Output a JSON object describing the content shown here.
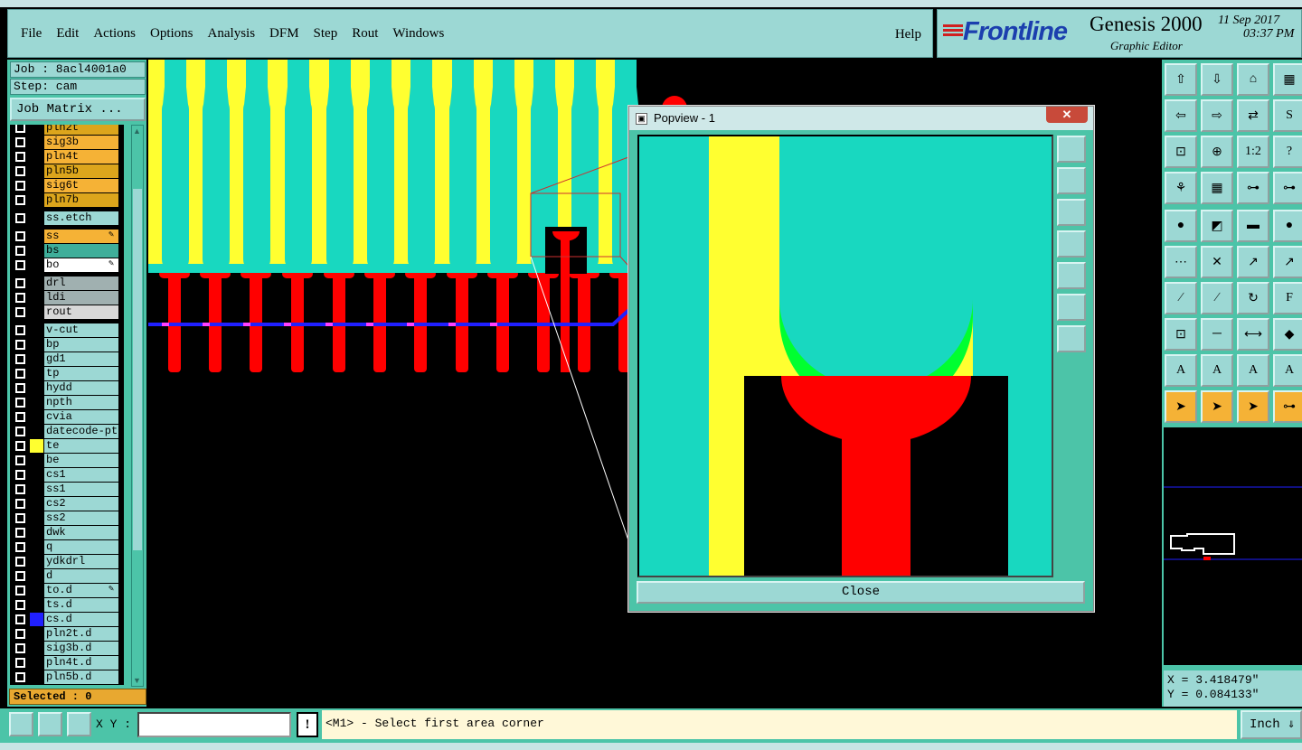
{
  "menu": {
    "items": [
      "File",
      "Edit",
      "Actions",
      "Options",
      "Analysis",
      "DFM",
      "Step",
      "Rout",
      "Windows"
    ],
    "help": "Help"
  },
  "brand": {
    "logo": "Frontline",
    "title": "Genesis 2000",
    "subtitle": "Graphic Editor",
    "date": "11 Sep 2017",
    "time": "03:37 PM"
  },
  "job": {
    "job_line": "Job : 8acl4001a0",
    "step_line": "Step: cam",
    "matrix_button": "Job Matrix ..."
  },
  "layers": [
    {
      "name": "pln2t",
      "color": "#dca51c",
      "mark": ""
    },
    {
      "name": "sig3b",
      "color": "#f5b236",
      "mark": ""
    },
    {
      "name": "pln4t",
      "color": "#f5b236",
      "mark": ""
    },
    {
      "name": "pln5b",
      "color": "#dca51c",
      "mark": ""
    },
    {
      "name": "sig6t",
      "color": "#f5b236",
      "mark": ""
    },
    {
      "name": "pln7b",
      "color": "#dca51c",
      "mark": ""
    },
    {
      "name": "ss.etch",
      "color": "#9cd8d4",
      "mark": ""
    },
    {
      "name": "ss",
      "color": "#f5b236",
      "mark": "✎"
    },
    {
      "name": "bs",
      "color": "#3fae9a",
      "mark": ""
    },
    {
      "name": "bo",
      "color": "#ffffff",
      "mark": "✎"
    },
    {
      "name": "drl",
      "color": "#a0b0b0",
      "mark": ""
    },
    {
      "name": "ldi",
      "color": "#a0b0b0",
      "mark": ""
    },
    {
      "name": "rout",
      "color": "#d8d8d8",
      "mark": ""
    },
    {
      "name": "v-cut",
      "color": "#9cd8d4",
      "mark": ""
    },
    {
      "name": "bp",
      "color": "#9cd8d4",
      "mark": ""
    },
    {
      "name": "gd1",
      "color": "#9cd8d4",
      "mark": ""
    },
    {
      "name": "tp",
      "color": "#9cd8d4",
      "mark": ""
    },
    {
      "name": "hydd",
      "color": "#9cd8d4",
      "mark": ""
    },
    {
      "name": "npth",
      "color": "#9cd8d4",
      "mark": ""
    },
    {
      "name": "cvia",
      "color": "#9cd8d4",
      "mark": ""
    },
    {
      "name": "datecode-pte",
      "color": "#9cd8d4",
      "mark": ""
    },
    {
      "name": "te",
      "color": "#9cd8d4",
      "mark": ""
    },
    {
      "name": "be",
      "color": "#9cd8d4",
      "mark": ""
    },
    {
      "name": "cs1",
      "color": "#9cd8d4",
      "mark": ""
    },
    {
      "name": "ss1",
      "color": "#9cd8d4",
      "mark": ""
    },
    {
      "name": "cs2",
      "color": "#9cd8d4",
      "mark": ""
    },
    {
      "name": "ss2",
      "color": "#9cd8d4",
      "mark": ""
    },
    {
      "name": "dwk",
      "color": "#9cd8d4",
      "mark": ""
    },
    {
      "name": "q",
      "color": "#9cd8d4",
      "mark": ""
    },
    {
      "name": "ydkdrl",
      "color": "#9cd8d4",
      "mark": ""
    },
    {
      "name": "d",
      "color": "#9cd8d4",
      "mark": ""
    },
    {
      "name": "to.d",
      "color": "#9cd8d4",
      "mark": "✎"
    },
    {
      "name": "ts.d",
      "color": "#9cd8d4",
      "mark": ""
    },
    {
      "name": "cs.d",
      "color": "#9cd8d4",
      "mark": ""
    },
    {
      "name": "pln2t.d",
      "color": "#9cd8d4",
      "mark": ""
    },
    {
      "name": "sig3b.d",
      "color": "#9cd8d4",
      "mark": ""
    },
    {
      "name": "pln4t.d",
      "color": "#9cd8d4",
      "mark": ""
    },
    {
      "name": "pln5b.d",
      "color": "#9cd8d4",
      "mark": ""
    }
  ],
  "selected": "Selected : 0",
  "popview": {
    "title": "Popview - 1",
    "close_x": "✕",
    "close_button": "Close"
  },
  "coords": {
    "x": "X = 3.418479\"",
    "y": "Y = 0.084133\""
  },
  "status": {
    "xy_label": "X Y :",
    "prompt": "<M1> - Select first area corner",
    "units": "Inch"
  },
  "tool_buttons": [
    "zoom-home-icon",
    "zoom-in-icon",
    "zoom-home-alt-icon",
    "split-view-icon",
    "pan-left-icon",
    "pan-right-icon",
    "flip-icon",
    "step-icon",
    "fit-icon",
    "center-icon",
    "one-to-two-icon",
    "help-icon",
    "snap-icon",
    "grid-icon",
    "connect-icon",
    "connect-alt-icon",
    "pad-add-icon",
    "surface-add-icon",
    "ruler-icon",
    "dot-icon",
    "net-icon",
    "intersect-icon",
    "pin-icon",
    "pin-alt-icon",
    "line-icon",
    "cut-icon",
    "arc-icon",
    "text-f-icon",
    "attr-icon",
    "slice-icon",
    "measure-icon",
    "shapes-icon",
    "text-a-icon",
    "text-a2-icon",
    "text-a3-icon",
    "text-a4-icon",
    "pointer-icon",
    "pointer-box-icon",
    "pointer-circle-icon",
    "pointer-net-icon"
  ],
  "colors": {
    "teal": "#18d8c0",
    "yellow": "#ffff30",
    "red": "#ff0000",
    "green": "#00ff30",
    "blue": "#2020ff",
    "panel": "#4cc4a8",
    "button": "#9cd8d4"
  }
}
